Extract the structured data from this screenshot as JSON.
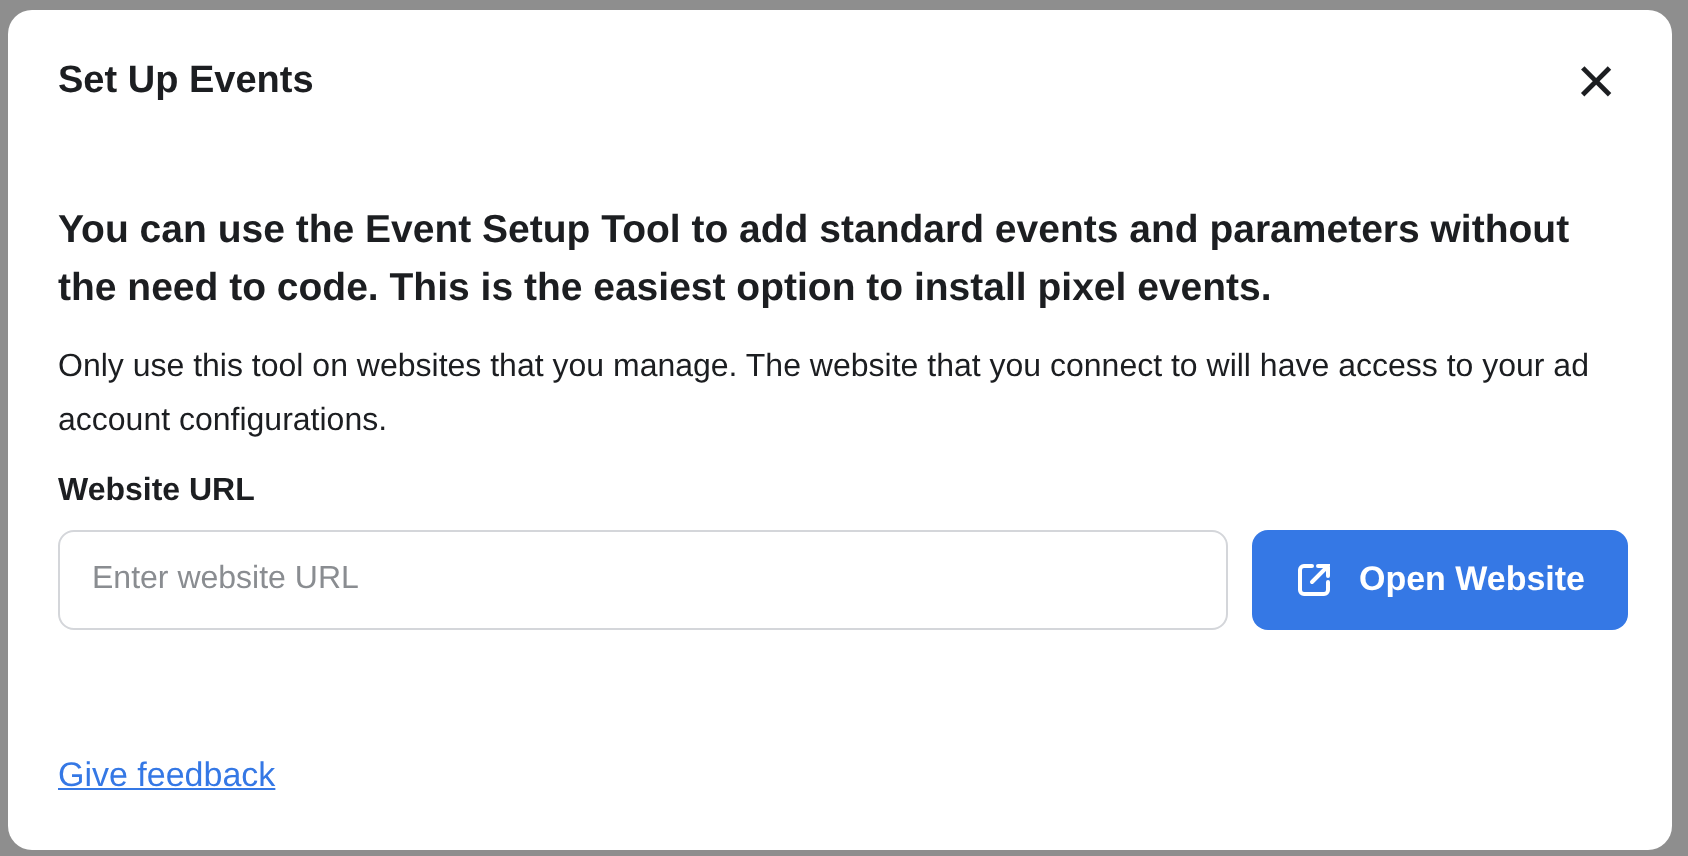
{
  "dialog": {
    "title": "Set Up Events",
    "close": "×"
  },
  "headline": "You can use the Event Setup Tool to add standard events and parameters without the need to code. This is the easiest option to install pixel events.",
  "description": "Only use this tool on websites that you manage. The website that you connect to will have access to your ad account configurations.",
  "url_field": {
    "label": "Website URL",
    "placeholder": "Enter website URL"
  },
  "open_button": "Open Website",
  "feedback_link": "Give feedback"
}
